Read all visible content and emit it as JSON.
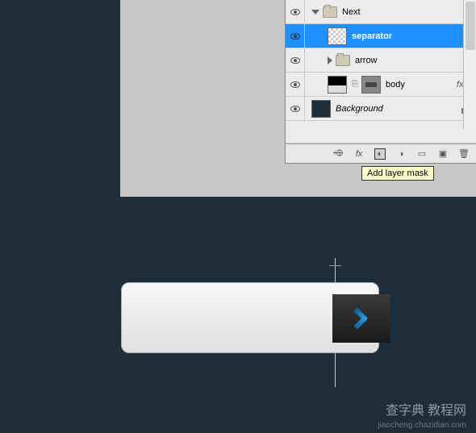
{
  "layers": {
    "group_name": "Next",
    "items": [
      {
        "name": "separator",
        "selected": true
      },
      {
        "name": "arrow",
        "is_group": true
      },
      {
        "name": "body",
        "has_fx": true,
        "fx_label": "fx"
      },
      {
        "name": "Background",
        "locked": true
      }
    ]
  },
  "tooltip": "Add layer mask",
  "watermark": {
    "main": "查字典 教程网",
    "sub": "jiaocheng.chazidian.com"
  }
}
